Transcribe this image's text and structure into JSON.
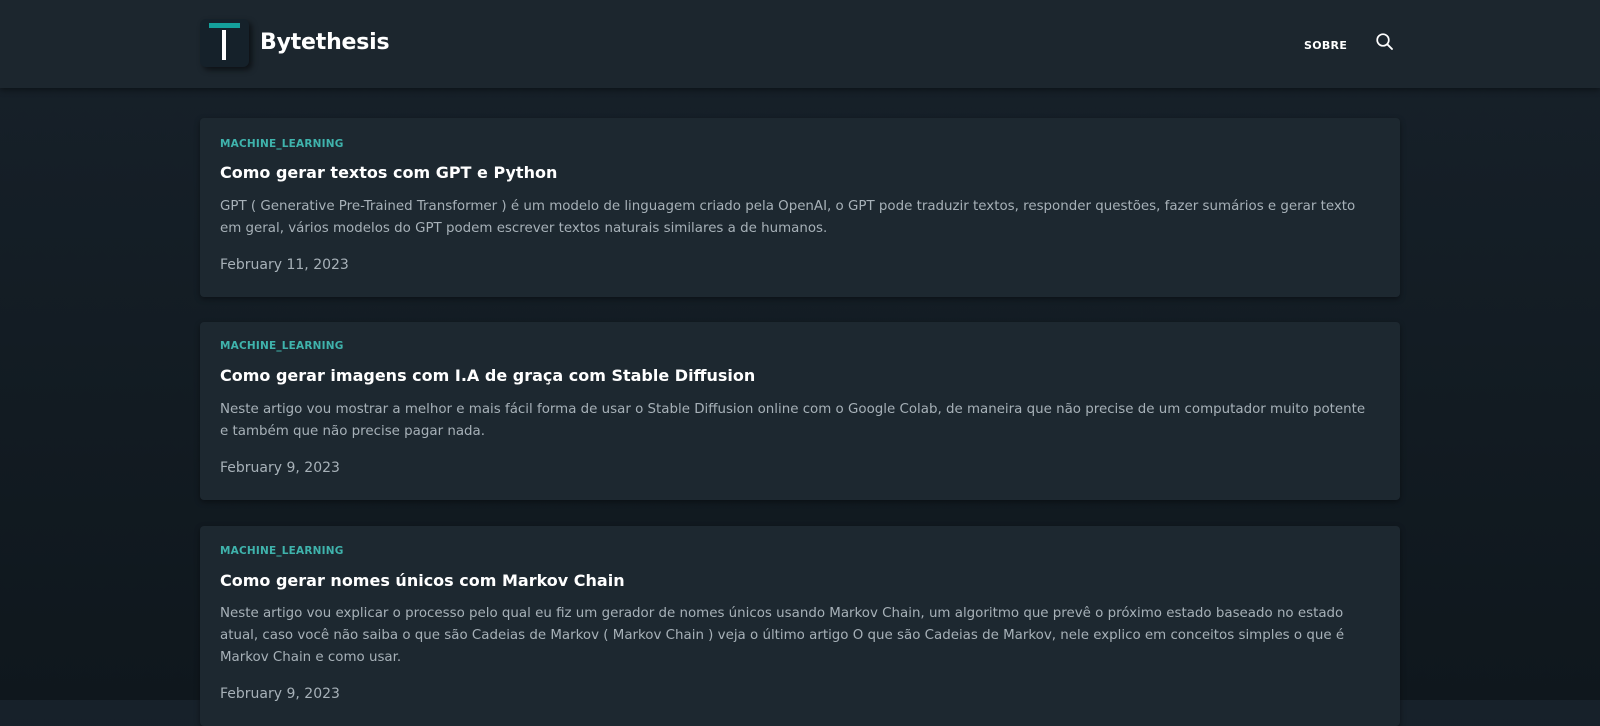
{
  "header": {
    "logo_icon": "T-logo-icon",
    "site_name": "Bytethesis",
    "nav": [
      {
        "label": "SOBRE"
      }
    ],
    "search_icon": "search-icon",
    "colors": {
      "accent": "#14a09b",
      "header_bg": "#1c262e",
      "page_bg": "#141d24"
    }
  },
  "posts": [
    {
      "category": "MACHINE_LEARNING",
      "title": "Como gerar textos com GPT e Python",
      "excerpt": "GPT ( Generative Pre-Trained Transformer ) é um modelo de linguagem criado pela OpenAI, o GPT pode traduzir textos, responder questões, fazer sumários e gerar texto em geral, vários modelos do GPT podem escrever textos naturais similares a de humanos.",
      "date": "February 11, 2023"
    },
    {
      "category": "MACHINE_LEARNING",
      "title": "Como gerar imagens com I.A de graça com Stable Diffusion",
      "excerpt": "Neste artigo vou mostrar a melhor e mais fácil forma de usar o Stable Diffusion online com o Google Colab, de maneira que não precise de um computador muito potente e também que não precise pagar nada.",
      "date": "February 9, 2023"
    },
    {
      "category": "MACHINE_LEARNING",
      "title": "Como gerar nomes únicos com Markov Chain",
      "excerpt": "Neste artigo vou explicar o processo pelo qual eu fiz um gerador de nomes únicos usando Markov Chain, um algoritmo que prevê o próximo estado baseado no estado atual, caso você não saiba o que são Cadeias de Markov ( Markov Chain ) veja o último artigo O que são Cadeias de Markov, nele explico em conceitos simples o que é Markov Chain e como usar.",
      "date": "February 9, 2023"
    }
  ]
}
